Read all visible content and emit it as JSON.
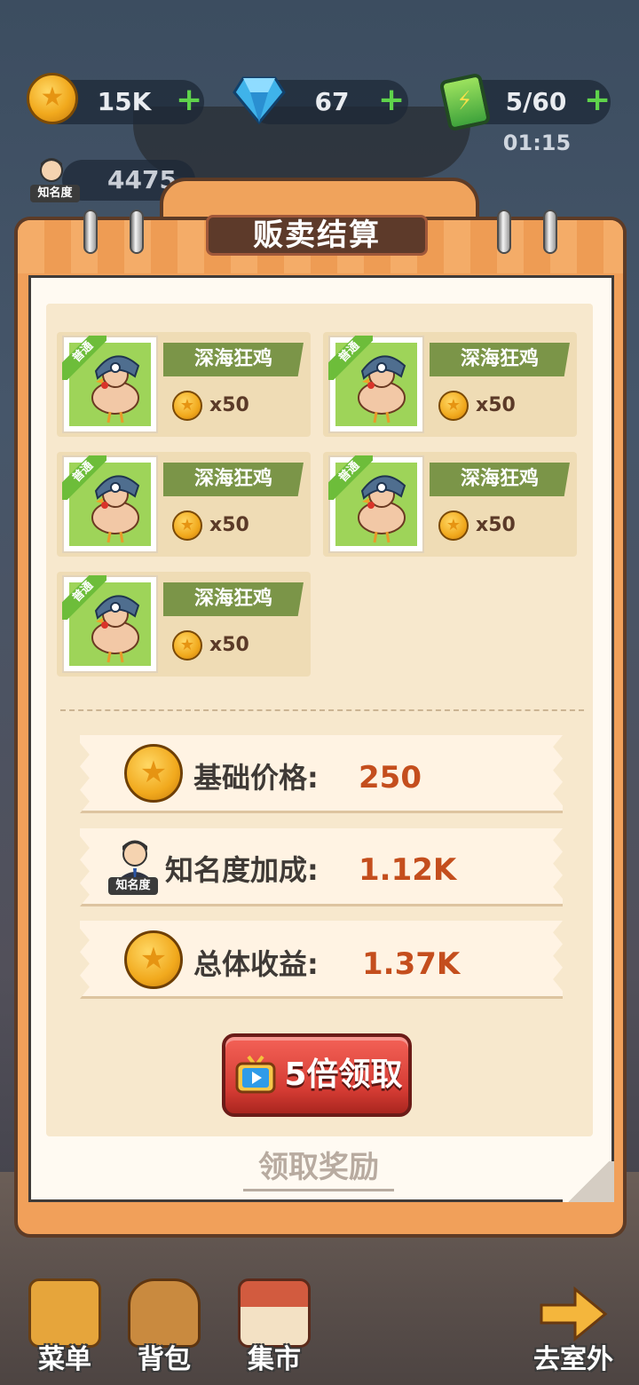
{
  "hud": {
    "coins": "15K",
    "gems": "67",
    "energy": "5/60",
    "energy_timer": "01:15",
    "plus": "+",
    "fame_badge": "知名度",
    "fame_value": "4475"
  },
  "modal": {
    "title": "贩卖结算",
    "items": [
      {
        "tag": "普通",
        "name": "深海狂鸡",
        "qty": "x50"
      },
      {
        "tag": "普通",
        "name": "深海狂鸡",
        "qty": "x50"
      },
      {
        "tag": "普通",
        "name": "深海狂鸡",
        "qty": "x50"
      },
      {
        "tag": "普通",
        "name": "深海狂鸡",
        "qty": "x50"
      },
      {
        "tag": "普通",
        "name": "深海狂鸡",
        "qty": "x50"
      }
    ],
    "stats": {
      "base_price_label": "基础价格:",
      "base_price_value": "250",
      "fame_bonus_label": "知名度加成:",
      "fame_bonus_value": "1.12K",
      "total_label": "总体收益:",
      "total_value": "1.37K",
      "fame_badge": "知名度"
    },
    "claim_5x_label": "5倍领取",
    "claim_label": "领取奖励"
  },
  "nav": {
    "menu": "菜单",
    "backpack": "背包",
    "market": "集市",
    "outdoor": "去室外"
  },
  "colors": {
    "accent_orange": "#f1a05a",
    "value_red": "#c44e1d",
    "button_red": "#d43b33",
    "plus_green": "#5fd34b"
  }
}
